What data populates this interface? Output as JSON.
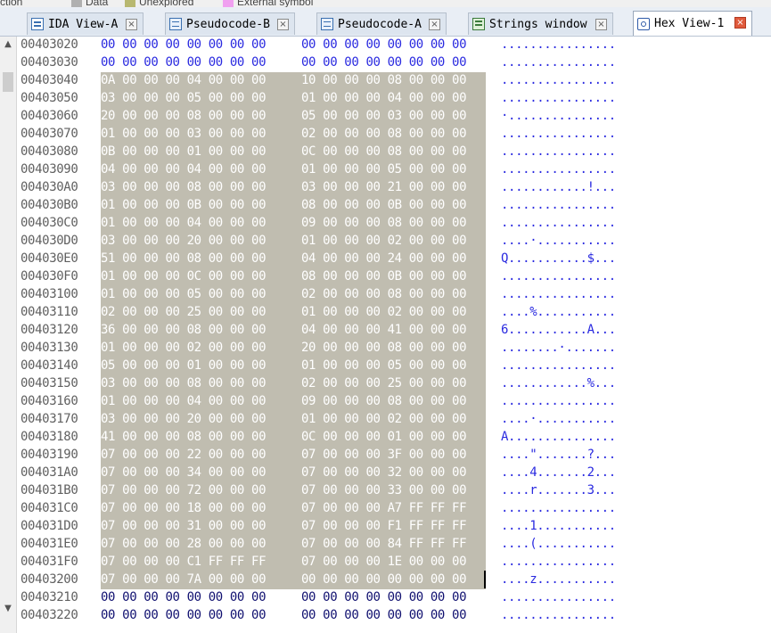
{
  "legend": [
    {
      "label": "truction",
      "color": ""
    },
    {
      "label": "Data",
      "color": "#b0b0b0"
    },
    {
      "label": "Unexplored",
      "color": "#b8b870"
    },
    {
      "label": "External symbol",
      "color": "#f0a0f0"
    }
  ],
  "tabs": [
    {
      "label": "IDA View-A",
      "icon": "ida-view-icon",
      "active": false
    },
    {
      "label": "Pseudocode-B",
      "icon": "pseudocode-icon",
      "active": false
    },
    {
      "label": "Pseudocode-A",
      "icon": "pseudocode-icon",
      "active": false
    },
    {
      "label": "Strings window",
      "icon": "strings-icon",
      "active": false
    },
    {
      "label": "Hex View-1",
      "icon": "hex-view-icon",
      "active": true
    }
  ],
  "tab_close_glyph": "×",
  "scroll": {
    "up": "▲",
    "down": "▼"
  },
  "colors": {
    "selection": "#c0bdb0",
    "ascii": "#2a2ae0",
    "address": "#606060",
    "zero_bytes": "#2a2ae0"
  },
  "hex_rows": [
    {
      "addr": "00403020",
      "h1": "00 00 00 00 00 00 00 00",
      "h2": "00 00 00 00 00 00 00 00",
      "ascii": "................",
      "style": "blue"
    },
    {
      "addr": "00403030",
      "h1": "00 00 00 00 00 00 00 00",
      "h2": "00 00 00 00 00 00 00 00",
      "ascii": "................",
      "style": "blue"
    },
    {
      "addr": "00403040",
      "h1": "0A 00 00 00 04 00 00 00",
      "h2": "10 00 00 00 08 00 00 00",
      "ascii": "................",
      "style": "sel"
    },
    {
      "addr": "00403050",
      "h1": "03 00 00 00 05 00 00 00",
      "h2": "01 00 00 00 04 00 00 00",
      "ascii": "................",
      "style": "sel"
    },
    {
      "addr": "00403060",
      "h1": "20 00 00 00 08 00 00 00",
      "h2": "05 00 00 00 03 00 00 00",
      "ascii": "·...............",
      "style": "sel"
    },
    {
      "addr": "00403070",
      "h1": "01 00 00 00 03 00 00 00",
      "h2": "02 00 00 00 08 00 00 00",
      "ascii": "................",
      "style": "sel"
    },
    {
      "addr": "00403080",
      "h1": "0B 00 00 00 01 00 00 00",
      "h2": "0C 00 00 00 08 00 00 00",
      "ascii": "................",
      "style": "sel"
    },
    {
      "addr": "00403090",
      "h1": "04 00 00 00 04 00 00 00",
      "h2": "01 00 00 00 05 00 00 00",
      "ascii": "................",
      "style": "sel"
    },
    {
      "addr": "004030A0",
      "h1": "03 00 00 00 08 00 00 00",
      "h2": "03 00 00 00 21 00 00 00",
      "ascii": "............!...",
      "style": "sel"
    },
    {
      "addr": "004030B0",
      "h1": "01 00 00 00 0B 00 00 00",
      "h2": "08 00 00 00 0B 00 00 00",
      "ascii": "................",
      "style": "sel"
    },
    {
      "addr": "004030C0",
      "h1": "01 00 00 00 04 00 00 00",
      "h2": "09 00 00 00 08 00 00 00",
      "ascii": "................",
      "style": "sel"
    },
    {
      "addr": "004030D0",
      "h1": "03 00 00 00 20 00 00 00",
      "h2": "01 00 00 00 02 00 00 00",
      "ascii": "....·...........",
      "style": "sel"
    },
    {
      "addr": "004030E0",
      "h1": "51 00 00 00 08 00 00 00",
      "h2": "04 00 00 00 24 00 00 00",
      "ascii": "Q...........$...",
      "style": "sel"
    },
    {
      "addr": "004030F0",
      "h1": "01 00 00 00 0C 00 00 00",
      "h2": "08 00 00 00 0B 00 00 00",
      "ascii": "................",
      "style": "sel"
    },
    {
      "addr": "00403100",
      "h1": "01 00 00 00 05 00 00 00",
      "h2": "02 00 00 00 08 00 00 00",
      "ascii": "................",
      "style": "sel"
    },
    {
      "addr": "00403110",
      "h1": "02 00 00 00 25 00 00 00",
      "h2": "01 00 00 00 02 00 00 00",
      "ascii": "....%...........",
      "style": "sel"
    },
    {
      "addr": "00403120",
      "h1": "36 00 00 00 08 00 00 00",
      "h2": "04 00 00 00 41 00 00 00",
      "ascii": "6...........A...",
      "style": "sel"
    },
    {
      "addr": "00403130",
      "h1": "01 00 00 00 02 00 00 00",
      "h2": "20 00 00 00 08 00 00 00",
      "ascii": "........·.......",
      "style": "sel"
    },
    {
      "addr": "00403140",
      "h1": "05 00 00 00 01 00 00 00",
      "h2": "01 00 00 00 05 00 00 00",
      "ascii": "................",
      "style": "sel"
    },
    {
      "addr": "00403150",
      "h1": "03 00 00 00 08 00 00 00",
      "h2": "02 00 00 00 25 00 00 00",
      "ascii": "............%...",
      "style": "sel"
    },
    {
      "addr": "00403160",
      "h1": "01 00 00 00 04 00 00 00",
      "h2": "09 00 00 00 08 00 00 00",
      "ascii": "................",
      "style": "sel"
    },
    {
      "addr": "00403170",
      "h1": "03 00 00 00 20 00 00 00",
      "h2": "01 00 00 00 02 00 00 00",
      "ascii": "....·...........",
      "style": "sel"
    },
    {
      "addr": "00403180",
      "h1": "41 00 00 00 08 00 00 00",
      "h2": "0C 00 00 00 01 00 00 00",
      "ascii": "A...............",
      "style": "sel"
    },
    {
      "addr": "00403190",
      "h1": "07 00 00 00 22 00 00 00",
      "h2": "07 00 00 00 3F 00 00 00",
      "ascii": "....\".......?...",
      "style": "sel"
    },
    {
      "addr": "004031A0",
      "h1": "07 00 00 00 34 00 00 00",
      "h2": "07 00 00 00 32 00 00 00",
      "ascii": "....4.......2...",
      "style": "sel"
    },
    {
      "addr": "004031B0",
      "h1": "07 00 00 00 72 00 00 00",
      "h2": "07 00 00 00 33 00 00 00",
      "ascii": "....r.......3...",
      "style": "sel"
    },
    {
      "addr": "004031C0",
      "h1": "07 00 00 00 18 00 00 00",
      "h2": "07 00 00 00 A7 FF FF FF",
      "ascii": "................",
      "style": "sel"
    },
    {
      "addr": "004031D0",
      "h1": "07 00 00 00 31 00 00 00",
      "h2": "07 00 00 00 F1 FF FF FF",
      "ascii": "....1...........",
      "style": "sel"
    },
    {
      "addr": "004031E0",
      "h1": "07 00 00 00 28 00 00 00",
      "h2": "07 00 00 00 84 FF FF FF",
      "ascii": "....(...........",
      "style": "sel"
    },
    {
      "addr": "004031F0",
      "h1": "07 00 00 00 C1 FF FF FF",
      "h2": "07 00 00 00 1E 00 00 00",
      "ascii": "................",
      "style": "sel"
    },
    {
      "addr": "00403200",
      "h1": "07 00 00 00 7A 00 00 00",
      "h2": "00 00 00 00 00 00 00 00",
      "ascii": "....z...........",
      "style": "sel"
    },
    {
      "addr": "00403210",
      "h1": "00 00 00 00 00 00 00 00",
      "h2": "00 00 00 00 00 00 00 00",
      "ascii": "................",
      "style": "navy"
    },
    {
      "addr": "00403220",
      "h1": "00 00 00 00 00 00 00 00",
      "h2": "00 00 00 00 00 00 00 00",
      "ascii": "................",
      "style": "navy"
    }
  ]
}
